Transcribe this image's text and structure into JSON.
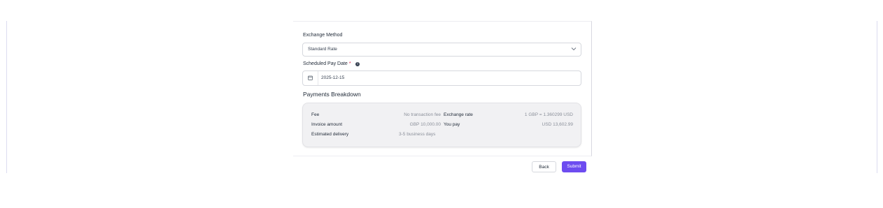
{
  "exchange_method": {
    "label": "Exchange Method",
    "selected": "Standard Rate"
  },
  "scheduled_pay_date": {
    "label": "Scheduled Pay Date",
    "required_mark": "*",
    "info": "i",
    "value": "2025-12-15"
  },
  "breakdown": {
    "title": "Payments Breakdown",
    "left_rows": [
      {
        "label": "Fee",
        "value": "No transaction fee"
      },
      {
        "label": "Invoice amount",
        "value": "GBP 10,000.00"
      },
      {
        "label": "Estimated delivery",
        "value": "3-5 business days"
      }
    ],
    "right_rows": [
      {
        "label": "Exchange rate",
        "value": "1 GBP = 1.360299 USD"
      },
      {
        "label": "You pay",
        "value": "USD 13,602.99"
      }
    ]
  },
  "actions": {
    "back_label": "Back",
    "submit_label": "Submit"
  },
  "colors": {
    "accent": "#6d4cf0",
    "required": "#e11d48",
    "card_bg": "#f1f1f3"
  }
}
